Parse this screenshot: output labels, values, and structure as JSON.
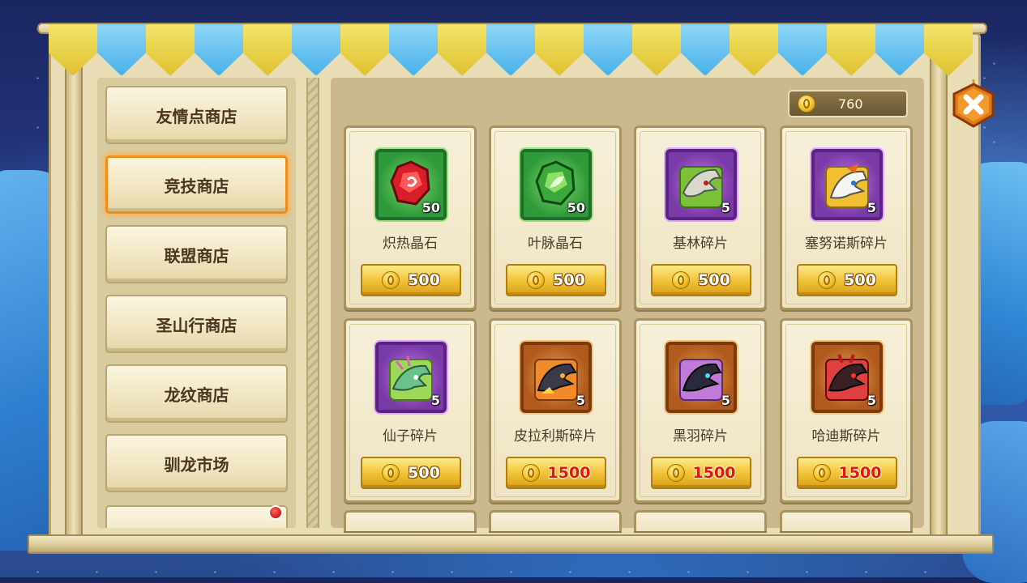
{
  "menu": {
    "items": [
      {
        "label": "友情点商店",
        "active": false
      },
      {
        "label": "竞技商店",
        "active": true
      },
      {
        "label": "联盟商店",
        "active": false
      },
      {
        "label": "圣山行商店",
        "active": false
      },
      {
        "label": "龙纹商店",
        "active": false
      },
      {
        "label": "驯龙市场",
        "active": false
      }
    ]
  },
  "currency": {
    "value": "760",
    "icon": "coin-icon"
  },
  "shop": {
    "items": [
      {
        "name": "炽热晶石",
        "qty": "50",
        "price": "500",
        "frame": "green",
        "icon": "red-crystal-icon"
      },
      {
        "name": "叶脉晶石",
        "qty": "50",
        "price": "500",
        "frame": "green",
        "icon": "green-crystal-icon"
      },
      {
        "name": "基林碎片",
        "qty": "5",
        "price": "500",
        "frame": "purple",
        "icon": "dragon-shard-icon"
      },
      {
        "name": "塞努诺斯碎片",
        "qty": "5",
        "price": "500",
        "frame": "purple",
        "icon": "dragon-shard-icon"
      },
      {
        "name": "仙子碎片",
        "qty": "5",
        "price": "500",
        "frame": "purple",
        "icon": "dragon-shard-icon"
      },
      {
        "name": "皮拉利斯碎片",
        "qty": "5",
        "price": "1500",
        "frame": "orange",
        "icon": "dragon-shard-icon"
      },
      {
        "name": "黑羽碎片",
        "qty": "5",
        "price": "1500",
        "frame": "orange",
        "icon": "dragon-shard-icon"
      },
      {
        "name": "哈迪斯碎片",
        "qty": "5",
        "price": "1500",
        "frame": "orange",
        "icon": "dragon-shard-icon"
      }
    ]
  },
  "colors": {
    "accent": "#f08c1a",
    "price_gold": "#f2c43a",
    "price_red": "#e01818"
  }
}
